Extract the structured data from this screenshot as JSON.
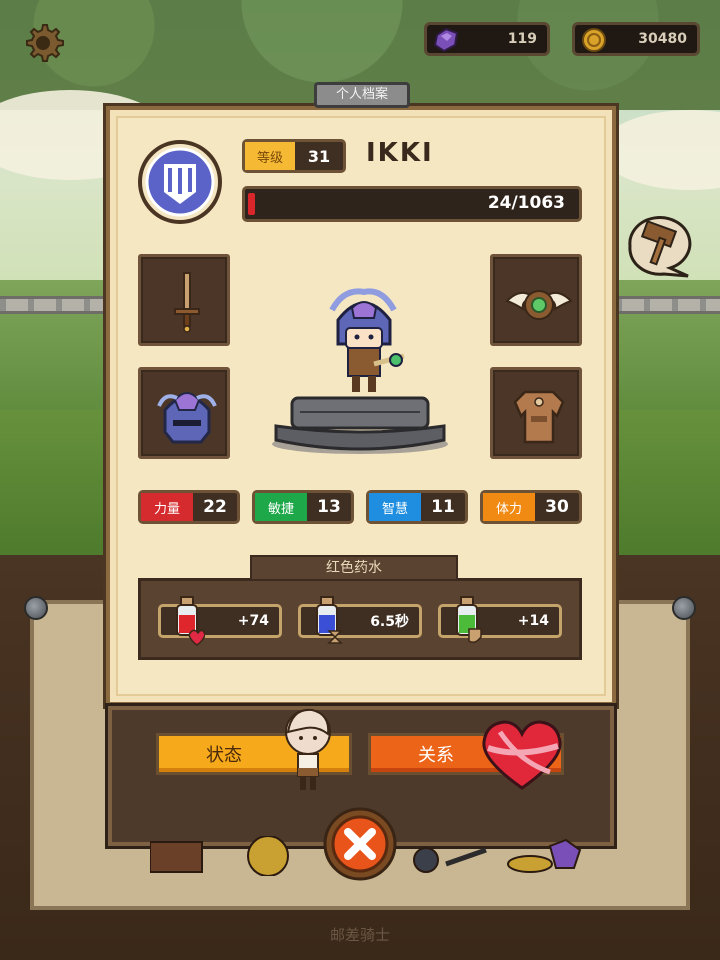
{
  "top_bar": {
    "gems": "119",
    "coins": "30480"
  },
  "panel": {
    "title": "个人档案"
  },
  "hero": {
    "level_label": "等级",
    "level": "31",
    "name": "IKKI",
    "xp_text": "24/1063",
    "xp_progress": 0.0226
  },
  "stats": [
    {
      "label": "力量",
      "value": "22",
      "color": "#d62b2e"
    },
    {
      "label": "敏捷",
      "value": "13",
      "color": "#1fa84a"
    },
    {
      "label": "智慧",
      "value": "11",
      "color": "#1f8ee0"
    },
    {
      "label": "体力",
      "value": "30",
      "color": "#f08a12"
    }
  ],
  "potion": {
    "title": "红色药水",
    "effects": [
      {
        "value": "+74",
        "icon": "red-potion-heart-icon"
      },
      {
        "value": "6.5秒",
        "icon": "blue-potion-hourglass-icon"
      },
      {
        "value": "+14",
        "icon": "green-potion-shield-icon"
      }
    ]
  },
  "buttons": {
    "status": "状态",
    "relation": "关系"
  },
  "footer": {
    "caption": "邮差骑士"
  },
  "colors": {
    "xp_fill": "#d8262b",
    "status_button": "#f6a91b",
    "relation_button": "#ec6418",
    "close_button": "#e8541a"
  }
}
